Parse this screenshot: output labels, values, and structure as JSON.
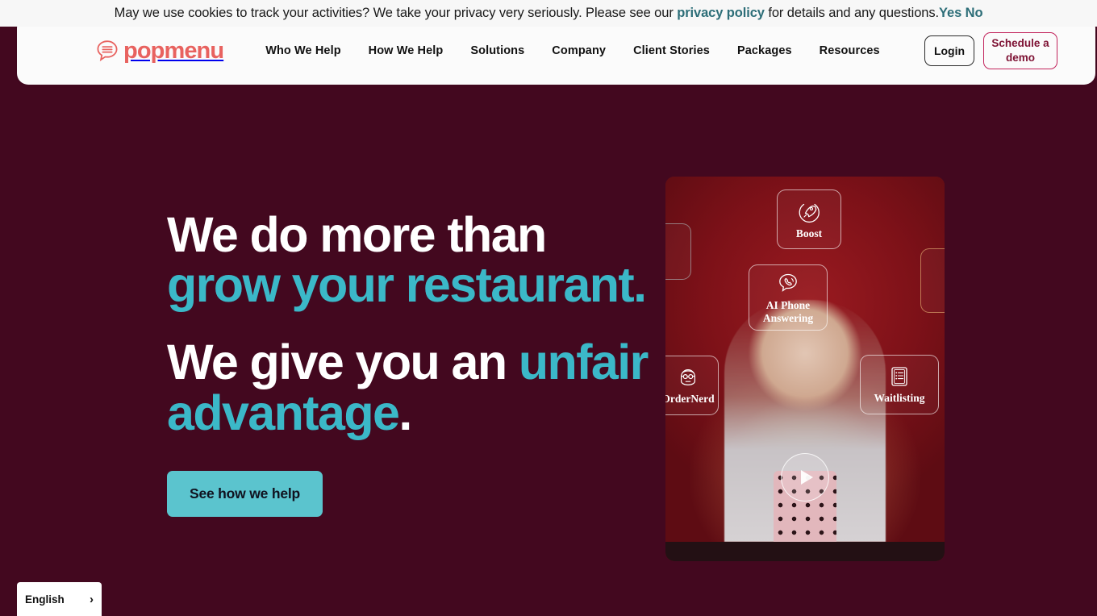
{
  "cookie_banner": {
    "text_before_link": "May we use cookies to track your activities? We take your privacy very seriously. Please see our ",
    "link_label": "privacy policy",
    "text_after_link": " for details and any questions.",
    "yes_label": "Yes",
    "no_label": "No",
    "link_color": "#2d6e78"
  },
  "header": {
    "logo_text": "popmenu",
    "logo_color": "#e8625f",
    "nav": [
      {
        "label": "Who We Help"
      },
      {
        "label": "How We Help"
      },
      {
        "label": "Solutions"
      },
      {
        "label": "Company"
      },
      {
        "label": "Client Stories"
      },
      {
        "label": "Packages"
      },
      {
        "label": "Resources"
      }
    ],
    "login_label": "Login",
    "demo_label": "Schedule a demo",
    "demo_border_color": "#c2245c",
    "demo_text_color": "#7d1133"
  },
  "hero": {
    "line1_a": "We do more than ",
    "line1_b": "grow your restaurant",
    "line1_c": ".",
    "line2_a": "We give you an ",
    "line2_b": "unfair advantage",
    "line2_c": ".",
    "highlight_color": "#3bb8c8",
    "text_color": "#ffffff",
    "cta_label": "See how we help",
    "cta_bg": "#5bc4ce",
    "cta_text_color": "#10121f",
    "background_color": "#43081f"
  },
  "video": {
    "play_label": "play-button",
    "feature_cards": [
      {
        "label": "Boost",
        "icon": "rocket-icon"
      },
      {
        "label": "AI Phone Answering",
        "icon": "phone-bubble-icon"
      },
      {
        "label": "OrderNerd",
        "icon": "nerd-face-icon"
      },
      {
        "label": "Waitlisting",
        "icon": "checklist-icon"
      }
    ]
  },
  "language_selector": {
    "label": "English",
    "chevron": "›"
  }
}
